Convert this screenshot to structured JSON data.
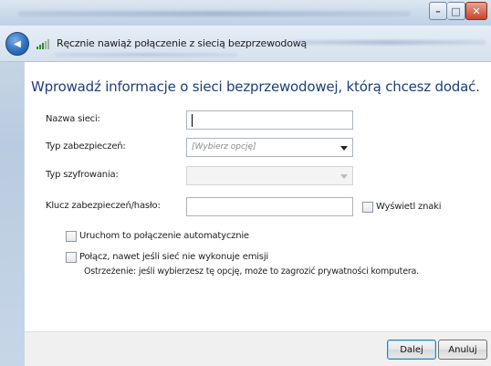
{
  "window": {
    "min_glyph": "–",
    "max_glyph": "□",
    "close_glyph": "✕"
  },
  "nav": {
    "back_glyph": "◀",
    "title": "Ręcznie nawiąż połączenie z siecią bezprzewodową"
  },
  "form": {
    "heading": "Wprowadź informacje o sieci bezprzewodowej, którą chcesz dodać.",
    "network_name_label": "Nazwa sieci:",
    "network_name_value": "",
    "security_type_label": "Typ zabezpieczeń:",
    "security_type_value": "[Wybierz opcję]",
    "encryption_type_label": "Typ szyfrowania:",
    "encryption_type_value": "",
    "security_key_label": "Klucz zabezpieczeń/hasło:",
    "security_key_value": "",
    "show_chars_label": "Wyświetl znaki",
    "auto_connect_label": "Uruchom to połączenie automatycznie",
    "connect_hidden_label": "Połącz, nawet jeśli sieć nie wykonuje emisji",
    "warning_text": "Ostrzeżenie: jeśli wybierzesz tę opcję, może to zagrozić prywatności komputera."
  },
  "footer": {
    "next_label": "Dalej",
    "cancel_label": "Anuluj"
  },
  "colors": {
    "heading": "#1e3f7a",
    "close_button": "#c7442b",
    "back_button": "#2f6fbe"
  }
}
